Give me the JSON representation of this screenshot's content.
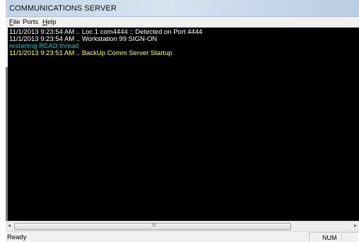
{
  "window": {
    "title": "COMMUNICATIONS SERVER"
  },
  "menu": [
    {
      "mnemonic": "F",
      "rest": "ile"
    },
    {
      "mnemonic": "",
      "rest": "Ports"
    },
    {
      "mnemonic": "H",
      "rest": "elp"
    }
  ],
  "console": {
    "lines": [
      {
        "text": "11/1/2013 9:23:54 AM .. Loc 1  com4444 :: Detected on Port 4444",
        "color": "#ffffff"
      },
      {
        "text": "11/1/2013 9:23:54 AM .. Workstation 99 SIGN-ON",
        "color": "#ffffff"
      },
      {
        "text": "restarting READ thread",
        "color": "#00c0c0"
      },
      {
        "text": "11/1/2013 9:23:51 AM .. BackUp Comm Server Startup",
        "color": "#ffff40"
      }
    ]
  },
  "scrollbar": {
    "left_arrow": "◂",
    "right_arrow": "▸",
    "grip": "III"
  },
  "status": {
    "text": "Ready",
    "num_indicator": "NUM"
  }
}
